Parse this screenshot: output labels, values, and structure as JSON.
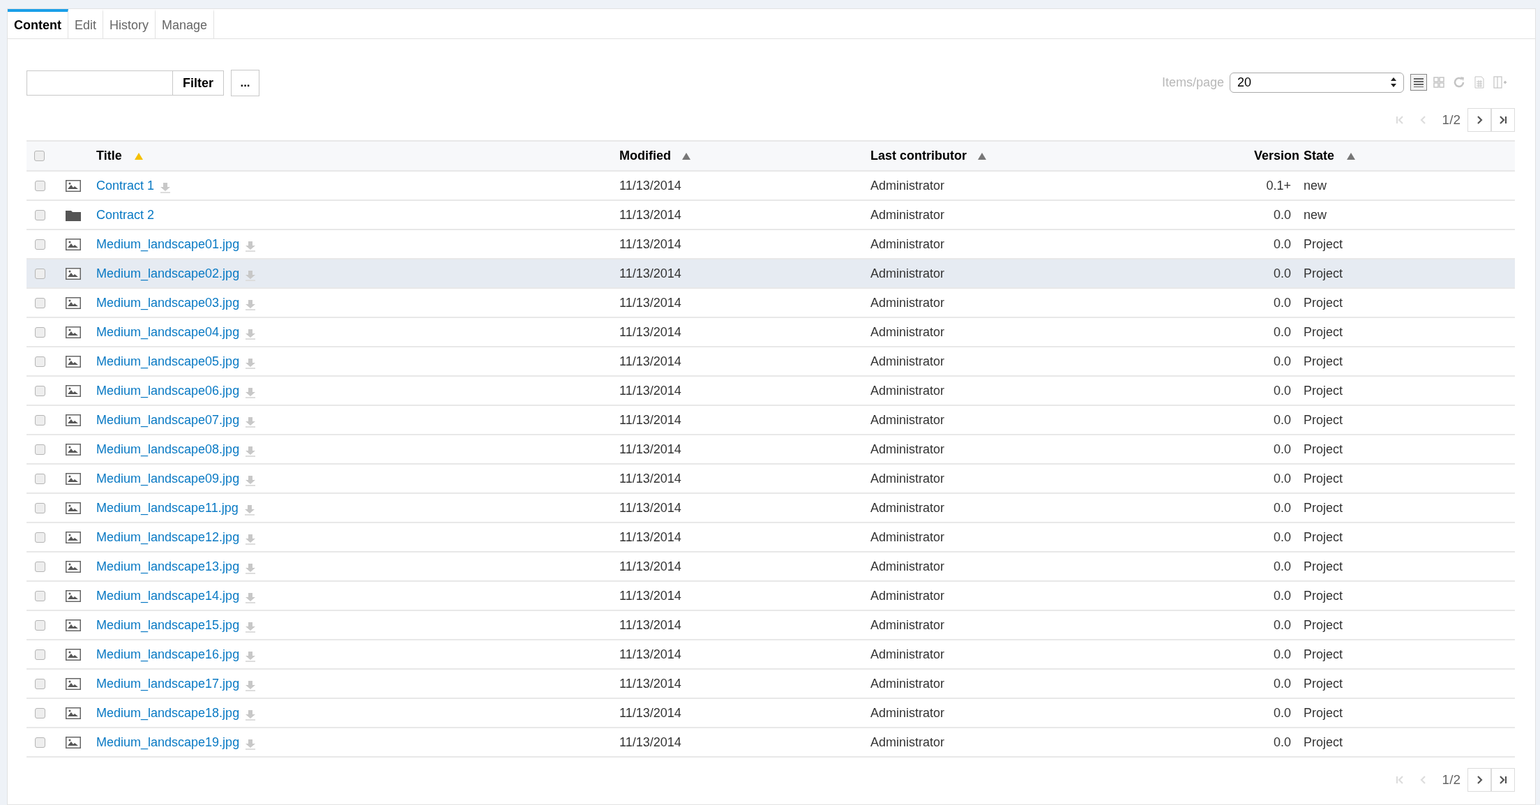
{
  "tabs": [
    {
      "label": "Content",
      "selected": true
    },
    {
      "label": "Edit",
      "selected": false
    },
    {
      "label": "History",
      "selected": false
    },
    {
      "label": "Manage",
      "selected": false
    }
  ],
  "filter": {
    "button": "Filter",
    "more_button": "..."
  },
  "items_per_page": {
    "label": "Items/page",
    "value": "20"
  },
  "view_tools": [
    {
      "kind": "list",
      "selected": true
    },
    {
      "kind": "grid",
      "selected": false
    },
    {
      "kind": "refresh",
      "selected": false
    },
    {
      "kind": "table",
      "selected": false
    },
    {
      "kind": "columns",
      "selected": false
    }
  ],
  "pager_top": {
    "page": "1/2",
    "first_disabled": true,
    "prev_disabled": true,
    "next_disabled": false,
    "last_disabled": false
  },
  "table": {
    "select_all_checked": false,
    "columns": [
      {
        "label": "Title",
        "sorted": true
      },
      {
        "label": "Modified",
        "sorted": false
      },
      {
        "label": "Last contributor",
        "sorted": false
      },
      {
        "label": "Version"
      },
      {
        "label": "State",
        "sorted": false
      }
    ],
    "rows": [
      {
        "kind": "image",
        "title": "Contract 1",
        "modified": "11/13/2014",
        "contributor": "Administrator",
        "version": "0.1+",
        "state": "new",
        "checked": false,
        "selected": false
      },
      {
        "kind": "folder",
        "title": "Contract 2",
        "modified": "11/13/2014",
        "contributor": "Administrator",
        "version": "0.0",
        "state": "new",
        "checked": false,
        "selected": false
      },
      {
        "kind": "image",
        "title": "Medium_landscape01.jpg",
        "modified": "11/13/2014",
        "contributor": "Administrator",
        "version": "0.0",
        "state": "Project",
        "checked": false,
        "selected": false
      },
      {
        "kind": "image",
        "title": "Medium_landscape02.jpg",
        "modified": "11/13/2014",
        "contributor": "Administrator",
        "version": "0.0",
        "state": "Project",
        "checked": false,
        "selected": true
      },
      {
        "kind": "image",
        "title": "Medium_landscape03.jpg",
        "modified": "11/13/2014",
        "contributor": "Administrator",
        "version": "0.0",
        "state": "Project",
        "checked": false,
        "selected": false
      },
      {
        "kind": "image",
        "title": "Medium_landscape04.jpg",
        "modified": "11/13/2014",
        "contributor": "Administrator",
        "version": "0.0",
        "state": "Project",
        "checked": false,
        "selected": false
      },
      {
        "kind": "image",
        "title": "Medium_landscape05.jpg",
        "modified": "11/13/2014",
        "contributor": "Administrator",
        "version": "0.0",
        "state": "Project",
        "checked": false,
        "selected": false
      },
      {
        "kind": "image",
        "title": "Medium_landscape06.jpg",
        "modified": "11/13/2014",
        "contributor": "Administrator",
        "version": "0.0",
        "state": "Project",
        "checked": false,
        "selected": false
      },
      {
        "kind": "image",
        "title": "Medium_landscape07.jpg",
        "modified": "11/13/2014",
        "contributor": "Administrator",
        "version": "0.0",
        "state": "Project",
        "checked": false,
        "selected": false
      },
      {
        "kind": "image",
        "title": "Medium_landscape08.jpg",
        "modified": "11/13/2014",
        "contributor": "Administrator",
        "version": "0.0",
        "state": "Project",
        "checked": false,
        "selected": false
      },
      {
        "kind": "image",
        "title": "Medium_landscape09.jpg",
        "modified": "11/13/2014",
        "contributor": "Administrator",
        "version": "0.0",
        "state": "Project",
        "checked": false,
        "selected": false
      },
      {
        "kind": "image",
        "title": "Medium_landscape11.jpg",
        "modified": "11/13/2014",
        "contributor": "Administrator",
        "version": "0.0",
        "state": "Project",
        "checked": false,
        "selected": false
      },
      {
        "kind": "image",
        "title": "Medium_landscape12.jpg",
        "modified": "11/13/2014",
        "contributor": "Administrator",
        "version": "0.0",
        "state": "Project",
        "checked": false,
        "selected": false
      },
      {
        "kind": "image",
        "title": "Medium_landscape13.jpg",
        "modified": "11/13/2014",
        "contributor": "Administrator",
        "version": "0.0",
        "state": "Project",
        "checked": false,
        "selected": false
      },
      {
        "kind": "image",
        "title": "Medium_landscape14.jpg",
        "modified": "11/13/2014",
        "contributor": "Administrator",
        "version": "0.0",
        "state": "Project",
        "checked": false,
        "selected": false
      },
      {
        "kind": "image",
        "title": "Medium_landscape15.jpg",
        "modified": "11/13/2014",
        "contributor": "Administrator",
        "version": "0.0",
        "state": "Project",
        "checked": false,
        "selected": false
      },
      {
        "kind": "image",
        "title": "Medium_landscape16.jpg",
        "modified": "11/13/2014",
        "contributor": "Administrator",
        "version": "0.0",
        "state": "Project",
        "checked": false,
        "selected": false
      },
      {
        "kind": "image",
        "title": "Medium_landscape17.jpg",
        "modified": "11/13/2014",
        "contributor": "Administrator",
        "version": "0.0",
        "state": "Project",
        "checked": false,
        "selected": false
      },
      {
        "kind": "image",
        "title": "Medium_landscape18.jpg",
        "modified": "11/13/2014",
        "contributor": "Administrator",
        "version": "0.0",
        "state": "Project",
        "checked": false,
        "selected": false
      },
      {
        "kind": "image",
        "title": "Medium_landscape19.jpg",
        "modified": "11/13/2014",
        "contributor": "Administrator",
        "version": "0.0",
        "state": "Project",
        "checked": false,
        "selected": false
      }
    ]
  },
  "pager_bottom": {
    "page": "1/2",
    "first_disabled": true,
    "prev_disabled": true,
    "next_disabled": false,
    "last_disabled": false
  }
}
